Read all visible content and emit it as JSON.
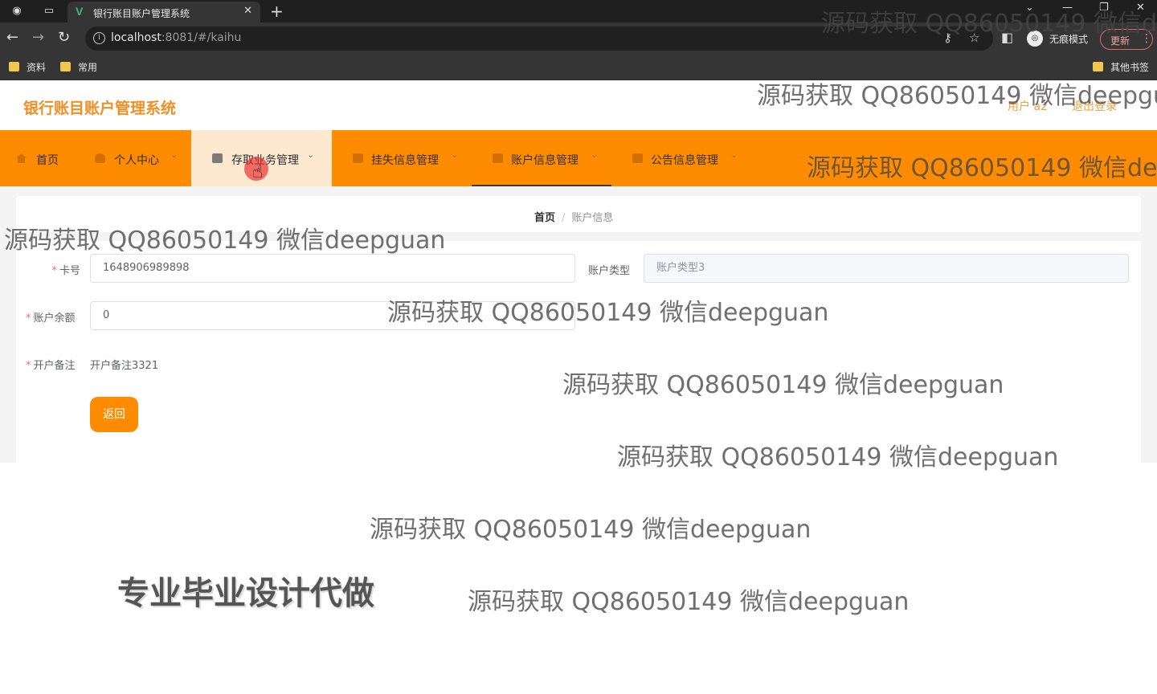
{
  "browser": {
    "tab_title": "银行账目账户管理系统",
    "tab_favicon": "V",
    "url_host": "localhost",
    "url_rest": ":8081/#/kaihu",
    "incognito_label": "无痕模式",
    "update_label": "更新",
    "bookmarks": [
      {
        "label": "资料"
      },
      {
        "label": "常用"
      },
      {
        "label": "其他书签"
      }
    ]
  },
  "app": {
    "title": "银行账目账户管理系统",
    "user_label": "用户 a2",
    "logout_label": "退出登录"
  },
  "menu": {
    "items": [
      {
        "label": "首页",
        "icon": "home-icon"
      },
      {
        "label": "个人中心",
        "icon": "user-icon"
      },
      {
        "label": "存取业务管理",
        "icon": "document-icon"
      },
      {
        "label": "挂失信息管理",
        "icon": "document-icon"
      },
      {
        "label": "账户信息管理",
        "icon": "document-icon"
      },
      {
        "label": "公告信息管理",
        "icon": "document-icon"
      }
    ]
  },
  "breadcrumb": {
    "home": "首页",
    "separator": "/",
    "current": "账户信息"
  },
  "form": {
    "card_number": {
      "label": "卡号",
      "value": "1648906989898"
    },
    "account_type": {
      "label": "账户类型",
      "value": "账户类型3"
    },
    "balance": {
      "label": "账户余额",
      "value": "0"
    },
    "remark": {
      "label": "开户备注",
      "value": "开户备注3321"
    },
    "back_label": "返回"
  },
  "watermarks": {
    "text": "源码获取 QQ86050149 微信deepguan",
    "promo": "专业毕业设计代做"
  },
  "colors": {
    "accent": "#ff8c00",
    "title": "#f09024",
    "required": "#f56c6c"
  }
}
